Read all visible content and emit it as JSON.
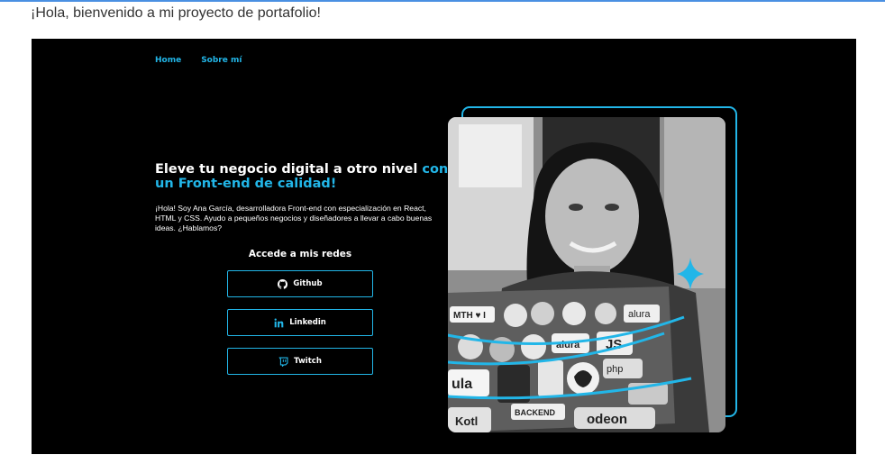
{
  "intro_text": "¡Hola, bienvenido a mi proyecto de portafolio!",
  "nav": {
    "home": "Home",
    "about": "Sobre mí"
  },
  "hero": {
    "title_main": "Eleve tu negocio digital a otro nivel ",
    "title_highlight": "con un Front-end de calidad!",
    "description": "¡Hola! Soy Ana García, desarrolladora Front-end con especialización en React, HTML y CSS. Ayudo a pequeños negocios y diseñadores a llevar a cabo buenas ideas. ¿Hablamos?"
  },
  "social": {
    "title": "Accede a mis redes",
    "github": "Github",
    "linkedin": "Linkedin",
    "twitch": "Twitch"
  },
  "colors": {
    "accent": "#22b6e8",
    "background": "#000000",
    "text": "#ffffff"
  },
  "icons": {
    "github": "github-icon",
    "linkedin": "linkedin-icon",
    "twitch": "twitch-icon",
    "sparkle": "sparkle-star-icon"
  },
  "photo_stickers": {
    "mth": "MTH ♥ I",
    "alura_1": "alura",
    "alura_2": "alura",
    "js": "JS",
    "ula": "ula",
    "php": "php",
    "backend": "BACKEND",
    "kotl": "Kotl",
    "codeon": "odeon"
  }
}
